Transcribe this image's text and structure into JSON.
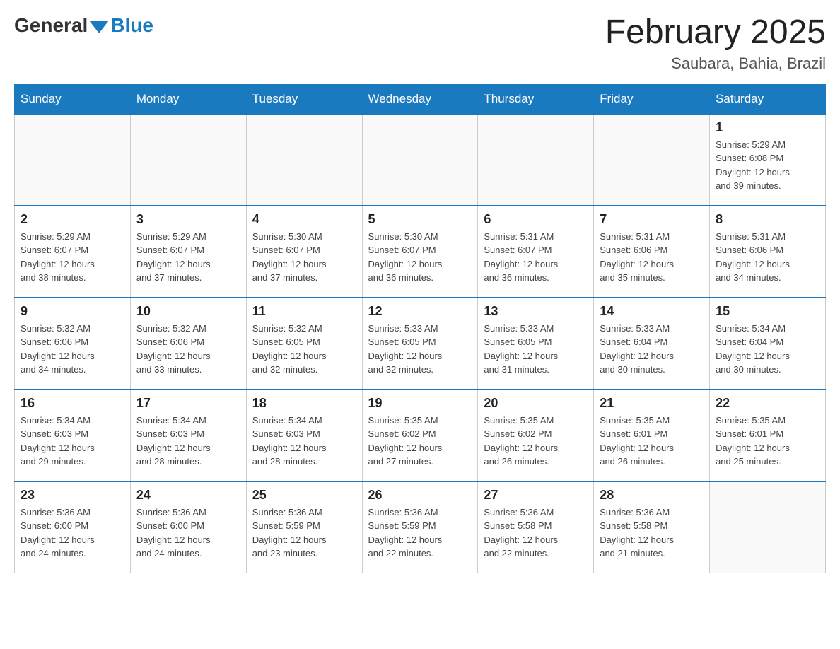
{
  "logo": {
    "general_text": "General",
    "blue_text": "Blue"
  },
  "title": {
    "month_year": "February 2025",
    "location": "Saubara, Bahia, Brazil"
  },
  "headers": [
    "Sunday",
    "Monday",
    "Tuesday",
    "Wednesday",
    "Thursday",
    "Friday",
    "Saturday"
  ],
  "weeks": [
    [
      {
        "day": "",
        "info": ""
      },
      {
        "day": "",
        "info": ""
      },
      {
        "day": "",
        "info": ""
      },
      {
        "day": "",
        "info": ""
      },
      {
        "day": "",
        "info": ""
      },
      {
        "day": "",
        "info": ""
      },
      {
        "day": "1",
        "info": "Sunrise: 5:29 AM\nSunset: 6:08 PM\nDaylight: 12 hours\nand 39 minutes."
      }
    ],
    [
      {
        "day": "2",
        "info": "Sunrise: 5:29 AM\nSunset: 6:07 PM\nDaylight: 12 hours\nand 38 minutes."
      },
      {
        "day": "3",
        "info": "Sunrise: 5:29 AM\nSunset: 6:07 PM\nDaylight: 12 hours\nand 37 minutes."
      },
      {
        "day": "4",
        "info": "Sunrise: 5:30 AM\nSunset: 6:07 PM\nDaylight: 12 hours\nand 37 minutes."
      },
      {
        "day": "5",
        "info": "Sunrise: 5:30 AM\nSunset: 6:07 PM\nDaylight: 12 hours\nand 36 minutes."
      },
      {
        "day": "6",
        "info": "Sunrise: 5:31 AM\nSunset: 6:07 PM\nDaylight: 12 hours\nand 36 minutes."
      },
      {
        "day": "7",
        "info": "Sunrise: 5:31 AM\nSunset: 6:06 PM\nDaylight: 12 hours\nand 35 minutes."
      },
      {
        "day": "8",
        "info": "Sunrise: 5:31 AM\nSunset: 6:06 PM\nDaylight: 12 hours\nand 34 minutes."
      }
    ],
    [
      {
        "day": "9",
        "info": "Sunrise: 5:32 AM\nSunset: 6:06 PM\nDaylight: 12 hours\nand 34 minutes."
      },
      {
        "day": "10",
        "info": "Sunrise: 5:32 AM\nSunset: 6:06 PM\nDaylight: 12 hours\nand 33 minutes."
      },
      {
        "day": "11",
        "info": "Sunrise: 5:32 AM\nSunset: 6:05 PM\nDaylight: 12 hours\nand 32 minutes."
      },
      {
        "day": "12",
        "info": "Sunrise: 5:33 AM\nSunset: 6:05 PM\nDaylight: 12 hours\nand 32 minutes."
      },
      {
        "day": "13",
        "info": "Sunrise: 5:33 AM\nSunset: 6:05 PM\nDaylight: 12 hours\nand 31 minutes."
      },
      {
        "day": "14",
        "info": "Sunrise: 5:33 AM\nSunset: 6:04 PM\nDaylight: 12 hours\nand 30 minutes."
      },
      {
        "day": "15",
        "info": "Sunrise: 5:34 AM\nSunset: 6:04 PM\nDaylight: 12 hours\nand 30 minutes."
      }
    ],
    [
      {
        "day": "16",
        "info": "Sunrise: 5:34 AM\nSunset: 6:03 PM\nDaylight: 12 hours\nand 29 minutes."
      },
      {
        "day": "17",
        "info": "Sunrise: 5:34 AM\nSunset: 6:03 PM\nDaylight: 12 hours\nand 28 minutes."
      },
      {
        "day": "18",
        "info": "Sunrise: 5:34 AM\nSunset: 6:03 PM\nDaylight: 12 hours\nand 28 minutes."
      },
      {
        "day": "19",
        "info": "Sunrise: 5:35 AM\nSunset: 6:02 PM\nDaylight: 12 hours\nand 27 minutes."
      },
      {
        "day": "20",
        "info": "Sunrise: 5:35 AM\nSunset: 6:02 PM\nDaylight: 12 hours\nand 26 minutes."
      },
      {
        "day": "21",
        "info": "Sunrise: 5:35 AM\nSunset: 6:01 PM\nDaylight: 12 hours\nand 26 minutes."
      },
      {
        "day": "22",
        "info": "Sunrise: 5:35 AM\nSunset: 6:01 PM\nDaylight: 12 hours\nand 25 minutes."
      }
    ],
    [
      {
        "day": "23",
        "info": "Sunrise: 5:36 AM\nSunset: 6:00 PM\nDaylight: 12 hours\nand 24 minutes."
      },
      {
        "day": "24",
        "info": "Sunrise: 5:36 AM\nSunset: 6:00 PM\nDaylight: 12 hours\nand 24 minutes."
      },
      {
        "day": "25",
        "info": "Sunrise: 5:36 AM\nSunset: 5:59 PM\nDaylight: 12 hours\nand 23 minutes."
      },
      {
        "day": "26",
        "info": "Sunrise: 5:36 AM\nSunset: 5:59 PM\nDaylight: 12 hours\nand 22 minutes."
      },
      {
        "day": "27",
        "info": "Sunrise: 5:36 AM\nSunset: 5:58 PM\nDaylight: 12 hours\nand 22 minutes."
      },
      {
        "day": "28",
        "info": "Sunrise: 5:36 AM\nSunset: 5:58 PM\nDaylight: 12 hours\nand 21 minutes."
      },
      {
        "day": "",
        "info": ""
      }
    ]
  ]
}
